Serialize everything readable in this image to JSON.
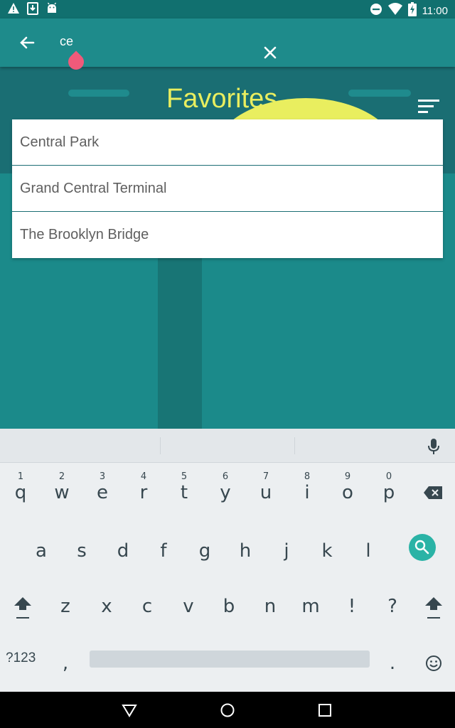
{
  "status_bar": {
    "time": "11:00",
    "icons": [
      "warning-icon",
      "download-icon",
      "android-icon",
      "do-not-disturb-icon",
      "wifi-icon",
      "battery-charging-icon"
    ]
  },
  "toolbar": {
    "query": "ce",
    "back_icon": "arrow-left-icon",
    "clear_icon": "close-icon"
  },
  "background": {
    "title": "Favorites",
    "menu_icon": "sort-icon"
  },
  "suggestions": [
    "Central Park",
    "Grand Central Terminal",
    "The Brooklyn Bridge"
  ],
  "keyboard": {
    "row1": [
      {
        "key": "q",
        "hint": "1"
      },
      {
        "key": "w",
        "hint": "2"
      },
      {
        "key": "e",
        "hint": "3"
      },
      {
        "key": "r",
        "hint": "4"
      },
      {
        "key": "t",
        "hint": "5"
      },
      {
        "key": "y",
        "hint": "6"
      },
      {
        "key": "u",
        "hint": "7"
      },
      {
        "key": "i",
        "hint": "8"
      },
      {
        "key": "o",
        "hint": "9"
      },
      {
        "key": "p",
        "hint": "0"
      }
    ],
    "row2": [
      "a",
      "s",
      "d",
      "f",
      "g",
      "h",
      "j",
      "k",
      "l"
    ],
    "row3": [
      "z",
      "x",
      "c",
      "v",
      "b",
      "n",
      "m",
      "!",
      "?"
    ],
    "symbols_label": "?123",
    "comma": ",",
    "period": "."
  },
  "colors": {
    "accent": "#e9ee5f",
    "toolbar": "#1e8b8b",
    "status": "#11706f",
    "search_key": "#2ab3a6"
  }
}
